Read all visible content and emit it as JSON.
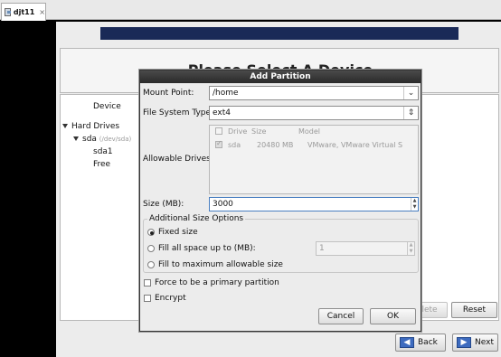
{
  "vm_tab": {
    "title": "djt11",
    "close": "×"
  },
  "installer": {
    "heading": "Please Select A Device",
    "device_column": "Device",
    "tree": {
      "hard_drives": "Hard Drives",
      "sda": "sda",
      "sda_path": "(/dev/sda)",
      "sda1": "sda1",
      "free": "Free"
    },
    "buttons": {
      "delete": "lete",
      "reset": "Reset",
      "back": "Back",
      "next": "Next"
    }
  },
  "dialog": {
    "title": "Add Partition",
    "mount_point": {
      "label": "Mount Point:",
      "value": "/home"
    },
    "fs_type": {
      "label": "File System Type:",
      "value": "ext4"
    },
    "allowable_drives": {
      "label": "Allowable Drives:",
      "headers": [
        "Drive",
        "Size",
        "Model"
      ],
      "row": {
        "checked": true,
        "drive": "sda",
        "size": "20480 MB",
        "model": "VMware, VMware Virtual S"
      }
    },
    "size": {
      "label": "Size (MB):",
      "value": "3000"
    },
    "additional": {
      "title": "Additional Size Options",
      "fixed": "Fixed size",
      "fill_up_to": "Fill all space up to (MB):",
      "fill_up_to_value": "1",
      "fill_max": "Fill to maximum allowable size",
      "selected": "fixed"
    },
    "force_primary": "Force to be a primary partition",
    "encrypt": "Encrypt",
    "cancel": "Cancel",
    "ok": "OK"
  }
}
